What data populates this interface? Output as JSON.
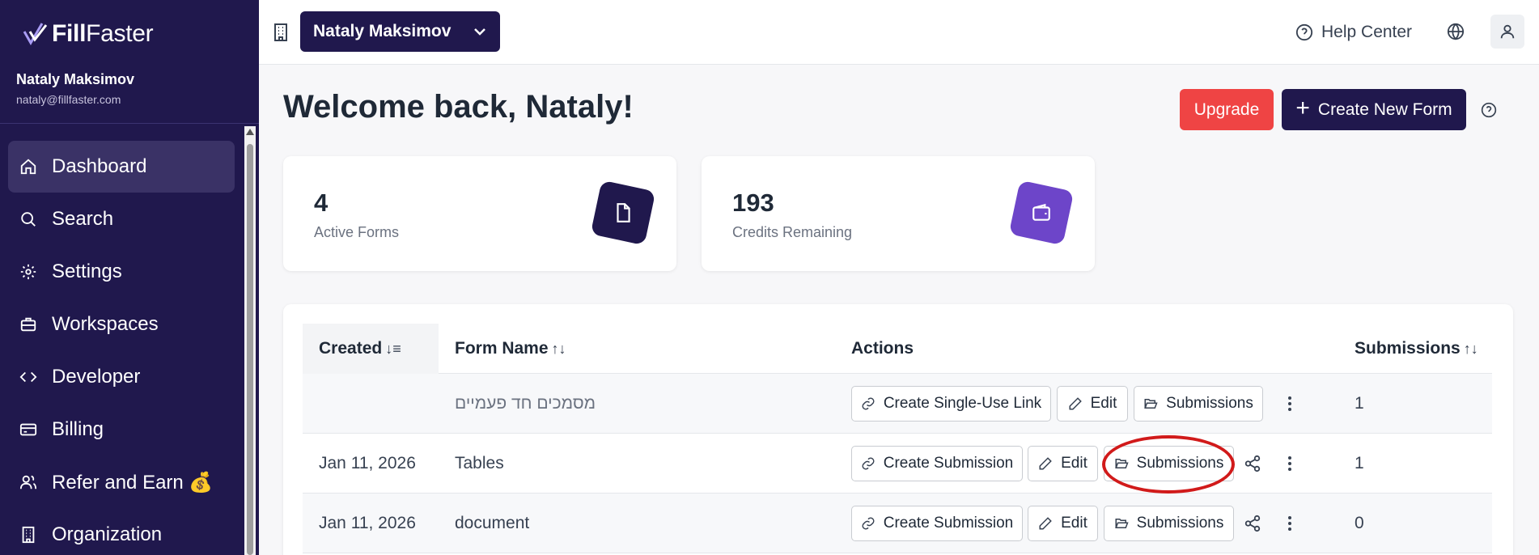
{
  "app": {
    "brand_bold": "Fill",
    "brand_light": "Faster",
    "accent": "#20184d",
    "upgrade_color": "#ef4444"
  },
  "user": {
    "name": "Nataly Maksimov",
    "email": "nataly@fillfaster.com"
  },
  "sidebar": {
    "items": [
      {
        "label": "Dashboard",
        "icon": "home-icon",
        "active": true
      },
      {
        "label": "Search",
        "icon": "search-icon"
      },
      {
        "label": "Settings",
        "icon": "gear-icon"
      },
      {
        "label": "Workspaces",
        "icon": "briefcase-icon"
      },
      {
        "label": "Developer",
        "icon": "code-icon"
      },
      {
        "label": "Billing",
        "icon": "credit-card-icon"
      },
      {
        "label": "Refer and Earn 💰",
        "icon": "users-icon"
      },
      {
        "label": "Organization",
        "icon": "building-icon"
      }
    ]
  },
  "topbar": {
    "workspace_name": "Nataly Maksimov",
    "help_label": "Help Center"
  },
  "main": {
    "welcome": "Welcome back, Nataly!",
    "upgrade_label": "Upgrade",
    "create_label": "Create New Form"
  },
  "stats": [
    {
      "value": "4",
      "label": "Active Forms",
      "color": "#20184d",
      "icon": "document-icon"
    },
    {
      "value": "193",
      "label": "Credits Remaining",
      "color": "#6d45c9",
      "icon": "wallet-icon"
    }
  ],
  "table": {
    "columns": {
      "created": "Created",
      "name": "Form Name",
      "actions": "Actions",
      "submissions": "Submissions"
    },
    "rows": [
      {
        "created": "",
        "name": "מסמכים חד פעמיים",
        "primary_action": "Create Single-Use Link",
        "edit": "Edit",
        "subs_btn": "Submissions",
        "submissions": "1"
      },
      {
        "created": "Jan 11, 2026",
        "name": "Tables",
        "primary_action": "Create Submission",
        "edit": "Edit",
        "subs_btn": "Submissions",
        "submissions": "1"
      },
      {
        "created": "Jan 11, 2026",
        "name": "document",
        "primary_action": "Create Submission",
        "edit": "Edit",
        "subs_btn": "Submissions",
        "submissions": "0"
      }
    ]
  }
}
